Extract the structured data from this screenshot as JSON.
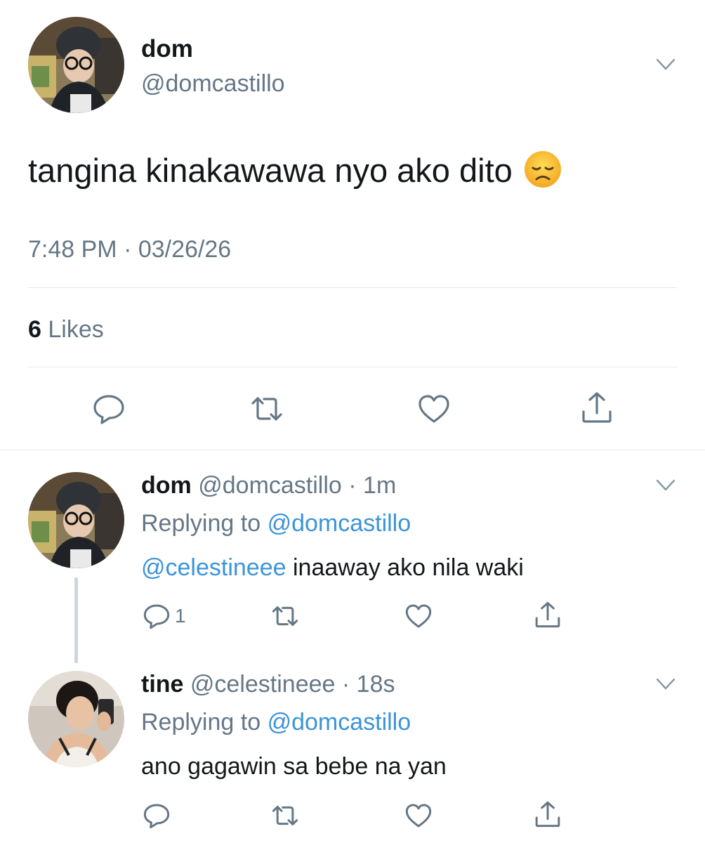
{
  "tweet": {
    "name": "dom",
    "handle": "@domcastillo",
    "text": "tangina kinakawawa nyo ako dito",
    "emoji": "disappointed-face-emoji",
    "timestamp": "7:48 PM · 03/26/26",
    "likes_count": "6",
    "likes_label": "Likes"
  },
  "replies": [
    {
      "name": "dom",
      "handle": "@domcastillo",
      "time": "1m",
      "replying_label": "Replying to",
      "replying_to": "@domcastillo",
      "mention": "@celestineee",
      "text": "inaaway ako nila waki",
      "reply_count": "1"
    },
    {
      "name": "tine",
      "handle": "@celestineee",
      "time": "18s",
      "replying_label": "Replying to",
      "replying_to": "@domcastillo",
      "text": "ano gagawin sa bebe na yan"
    }
  ],
  "colors": {
    "text": "#14171a",
    "secondary": "#657786",
    "link": "#3b94d9",
    "divider": "#e1e8ed"
  }
}
